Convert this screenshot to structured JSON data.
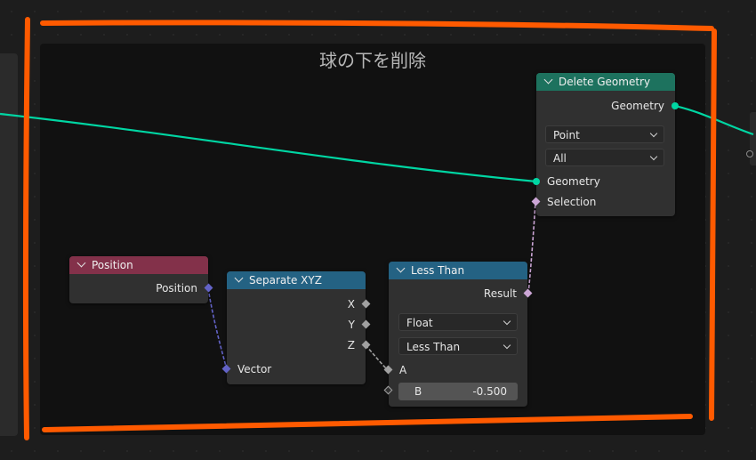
{
  "frame": {
    "title": "球の下を削除"
  },
  "nodes": {
    "position": {
      "title": "Position",
      "header_color": "#83314a",
      "outputs": {
        "position": "Position"
      }
    },
    "separate_xyz": {
      "title": "Separate XYZ",
      "header_color": "#246283",
      "outputs": {
        "x": "X",
        "y": "Y",
        "z": "Z"
      },
      "inputs": {
        "vector": "Vector"
      }
    },
    "less_than": {
      "title": "Less Than",
      "header_color": "#246283",
      "outputs": {
        "result": "Result"
      },
      "data_type": "Float",
      "operation": "Less Than",
      "inputs": {
        "a": "A",
        "b_label": "B",
        "b_value": "-0.500"
      }
    },
    "delete_geometry": {
      "title": "Delete Geometry",
      "header_color": "#1d725e",
      "outputs": {
        "geometry": "Geometry"
      },
      "domain": "Point",
      "mode": "All",
      "inputs": {
        "geometry": "Geometry",
        "selection": "Selection"
      }
    }
  },
  "colors": {
    "geometry_socket": "#00d6a3",
    "vector_socket": "#6363c7",
    "boolean_socket": "#cca6d6",
    "float_socket": "#a1a1a1",
    "annotation": "#ff5a00"
  }
}
